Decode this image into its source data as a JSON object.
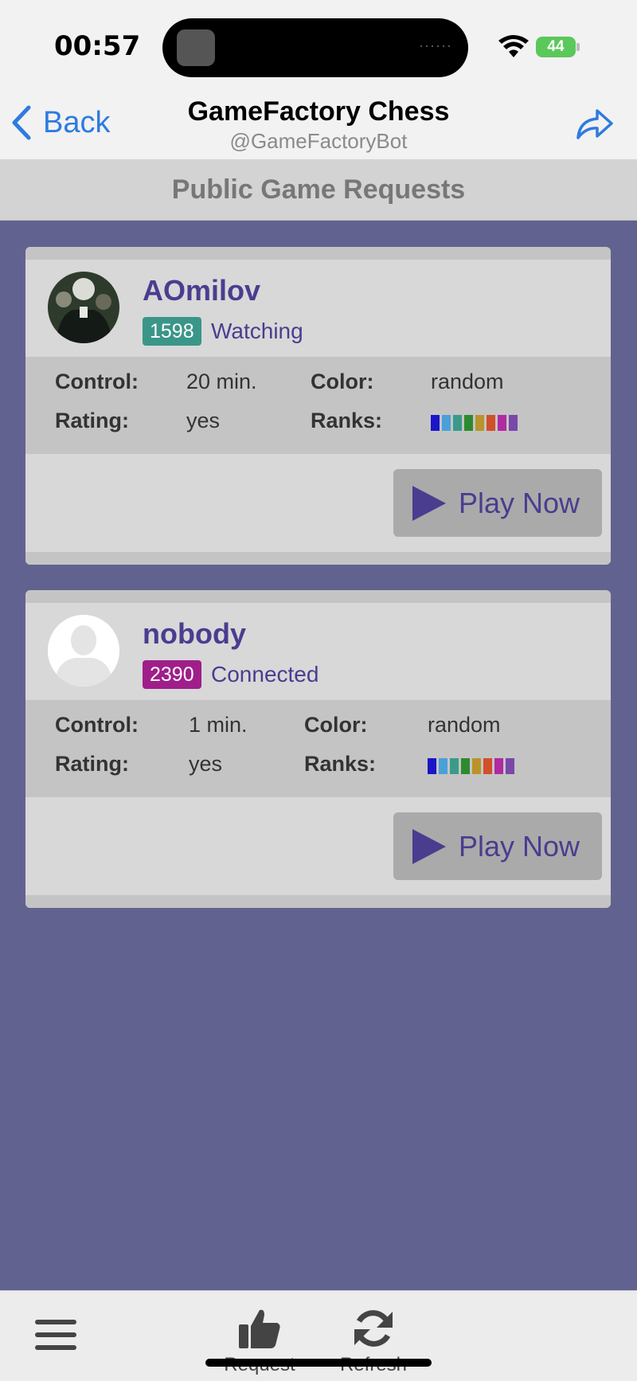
{
  "status_bar": {
    "time": "00:57",
    "island_dots": "······",
    "battery": "44"
  },
  "nav": {
    "back_label": "Back",
    "title": "GameFactory Chess",
    "subtitle": "@GameFactoryBot"
  },
  "section": {
    "title": "Public Game Requests"
  },
  "labels": {
    "control": "Control:",
    "color": "Color:",
    "rating": "Rating:",
    "ranks": "Ranks:"
  },
  "requests": [
    {
      "name": "AOmilov",
      "rating": "1598",
      "rating_color": "#3a9688",
      "status": "Watching",
      "control": "20 min.",
      "color": "random",
      "rated": "yes",
      "play_label": "Play Now"
    },
    {
      "name": "nobody",
      "rating": "2390",
      "rating_color": "#a01e8a",
      "status": "Connected",
      "control": "1 min.",
      "color": "random",
      "rated": "yes",
      "play_label": "Play Now"
    }
  ],
  "rank_colors": [
    "#1a16c8",
    "#4aa0d8",
    "#3a9a8a",
    "#2e8a2e",
    "#b8942a",
    "#d0502a",
    "#b02aa0",
    "#7a48a8"
  ],
  "toolbar": {
    "request_label": "Request",
    "refresh_label": "Refresh"
  }
}
